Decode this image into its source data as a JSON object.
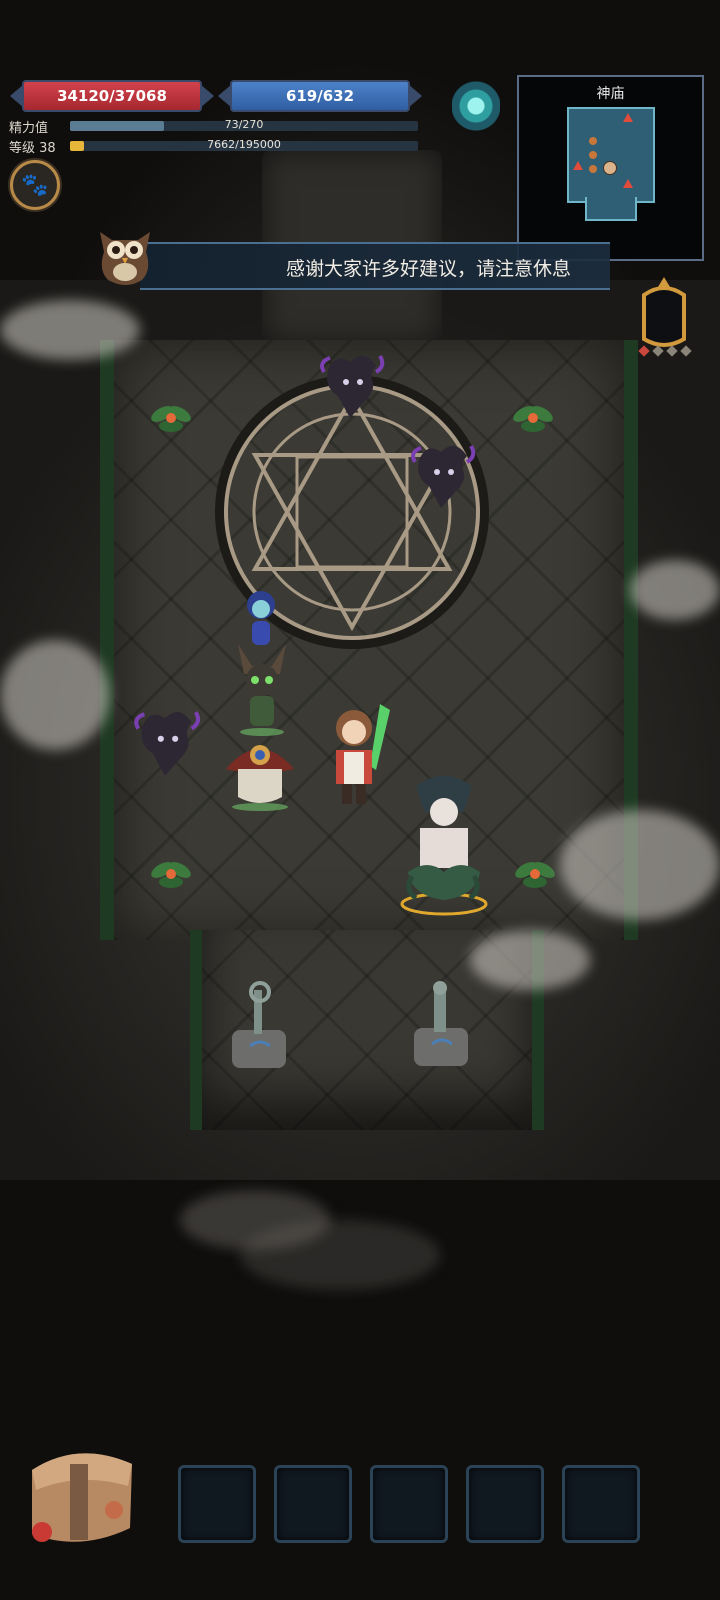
{
  "hud": {
    "hp_text": "34120/37068",
    "hp_fraction": 0.92,
    "mp_text": "619/632",
    "mp_fraction": 0.98,
    "stamina_label": "精力值",
    "stamina_text": "73/270",
    "stamina_fraction": 0.27,
    "level_label": "等级 38",
    "exp_text": "7662/195000",
    "exp_fraction": 0.04
  },
  "minimap": {
    "title": "神庙"
  },
  "banner": {
    "message": "感谢大家许多好建议，请注意休息"
  },
  "icons": {
    "portal": "portal-icon",
    "pet": "paw-icon",
    "owl": "owl-icon",
    "relic": "crest-icon",
    "backpack": "backpack-icon"
  },
  "colors": {
    "hp": "#c8343d",
    "mp": "#3f72b8",
    "stamina": "#5a7d93",
    "exp": "#e7b73a",
    "minimap_room": "#2f5f74",
    "enemy_marker": "#e04b3c"
  },
  "inventory": {
    "slots": [
      "",
      "",
      "",
      "",
      ""
    ]
  }
}
